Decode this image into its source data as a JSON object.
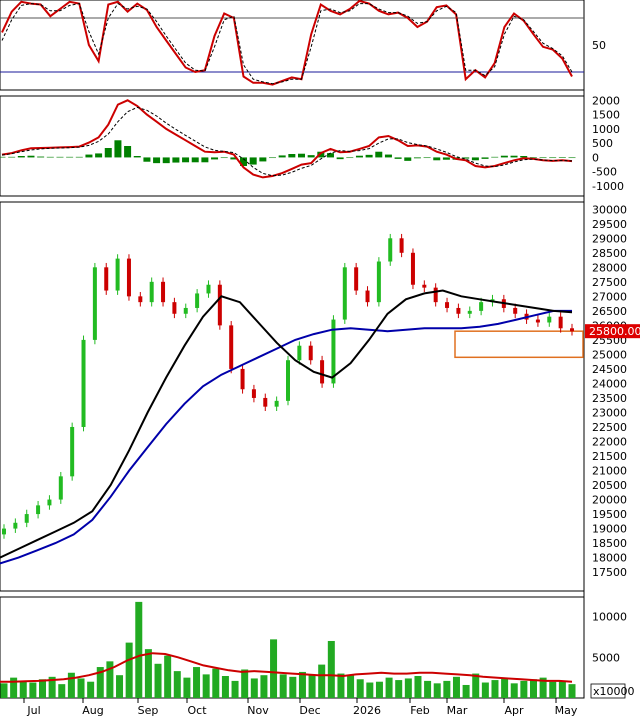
{
  "chart_data": [
    {
      "panel": "stochastic",
      "type": "line",
      "yticks": [
        50
      ],
      "ylim": [
        0,
        100
      ],
      "reference_lines": [
        80,
        20
      ],
      "series": [
        {
          "color": "#cc0000",
          "values": [
            64,
            87,
            98,
            96,
            95,
            82,
            90,
            98,
            96,
            50,
            32,
            95,
            98,
            87,
            96,
            89,
            70,
            55,
            40,
            25,
            20,
            22,
            60,
            85,
            80,
            15,
            8,
            8,
            6,
            10,
            14,
            12,
            62,
            95,
            88,
            84,
            90,
            99,
            96,
            88,
            84,
            86,
            80,
            70,
            76,
            92,
            94,
            84,
            12,
            22,
            14,
            30,
            70,
            85,
            77,
            62,
            48,
            45,
            35,
            15
          ]
        },
        {
          "color": "#000000",
          "dashed": true,
          "values": [
            55,
            78,
            94,
            96,
            95,
            88,
            88,
            94,
            96,
            65,
            40,
            80,
            96,
            90,
            93,
            90,
            76,
            60,
            45,
            30,
            22,
            21,
            48,
            78,
            82,
            28,
            12,
            9,
            7,
            9,
            12,
            12,
            48,
            88,
            90,
            86,
            88,
            96,
            96,
            90,
            86,
            86,
            82,
            74,
            76,
            88,
            93,
            86,
            22,
            22,
            16,
            26,
            62,
            82,
            78,
            65,
            52,
            46,
            38,
            20
          ]
        }
      ]
    },
    {
      "panel": "macd",
      "type": "line",
      "yticks": [
        2000,
        1500,
        1000,
        500,
        0,
        -500,
        -1000
      ],
      "ylim": [
        -1350,
        2150
      ],
      "series": [
        {
          "color": "#cc0000",
          "values": [
            100,
            150,
            250,
            320,
            330,
            340,
            350,
            360,
            380,
            520,
            700,
            1150,
            1850,
            2000,
            1800,
            1500,
            1250,
            1000,
            800,
            600,
            400,
            200,
            180,
            200,
            100,
            -350,
            -600,
            -700,
            -650,
            -550,
            -400,
            -250,
            -200,
            150,
            300,
            180,
            200,
            300,
            400,
            700,
            750,
            600,
            400,
            420,
            380,
            200,
            100,
            -50,
            -100,
            -300,
            -350,
            -300,
            -200,
            -100,
            -30,
            -50,
            -100,
            -120,
            -100,
            -130
          ]
        },
        {
          "color": "#000000",
          "dashed": true,
          "values": [
            80,
            130,
            200,
            260,
            300,
            320,
            330,
            340,
            360,
            420,
            560,
            820,
            1250,
            1600,
            1750,
            1650,
            1450,
            1200,
            980,
            770,
            570,
            370,
            250,
            210,
            170,
            -50,
            -350,
            -560,
            -640,
            -620,
            -520,
            -380,
            -280,
            -50,
            150,
            240,
            210,
            240,
            310,
            500,
            650,
            650,
            520,
            450,
            400,
            300,
            180,
            30,
            -60,
            -200,
            -300,
            -320,
            -260,
            -160,
            -80,
            -60,
            -90,
            -110,
            -110,
            -120
          ]
        }
      ],
      "histogram": {
        "color": "#008000",
        "values": [
          20,
          20,
          50,
          60,
          30,
          20,
          20,
          20,
          20,
          100,
          140,
          330,
          600,
          400,
          50,
          -150,
          -200,
          -200,
          -180,
          -170,
          -170,
          -170,
          -70,
          -10,
          -70,
          -300,
          -250,
          -140,
          -10,
          70,
          120,
          130,
          80,
          200,
          150,
          -60,
          -10,
          60,
          90,
          200,
          100,
          -50,
          -120,
          -30,
          -20,
          -100,
          -80,
          -80,
          -40,
          -100,
          -50,
          20,
          60,
          60,
          50,
          10,
          -10,
          -10,
          10,
          -10
        ]
      }
    },
    {
      "panel": "price",
      "type": "candlestick",
      "yticks": [
        30000,
        29500,
        29000,
        28500,
        28000,
        27500,
        27000,
        26500,
        26000,
        25500,
        25000,
        24500,
        24000,
        23500,
        23000,
        22500,
        22000,
        21500,
        21000,
        20500,
        20000,
        19500,
        19000,
        18500,
        18000,
        17500
      ],
      "ylim": [
        16850,
        30250
      ],
      "x": [
        "Jul",
        "Aug",
        "Sep",
        "Oct",
        "Nov",
        "Dec",
        "2026",
        "Feb",
        "Mar",
        "Apr",
        "May"
      ],
      "last_price": "25800.00",
      "close": [
        19000,
        19200,
        19500,
        19800,
        20000,
        20800,
        22500,
        25500,
        28000,
        27200,
        28300,
        27000,
        26800,
        27500,
        26800,
        26400,
        26600,
        27100,
        27400,
        26000,
        24500,
        23800,
        23500,
        23200,
        23400,
        24800,
        25300,
        24800,
        24000,
        26200,
        28000,
        27200,
        26800,
        28200,
        29000,
        28500,
        27400,
        27300,
        26800,
        26600,
        26400,
        26500,
        26800,
        26900,
        26600,
        26400,
        26200,
        26100,
        26300,
        25900,
        25800
      ],
      "sma_short": {
        "color": "#000000",
        "values": [
          18000,
          18300,
          18600,
          18900,
          19200,
          19600,
          20500,
          21700,
          23000,
          24200,
          25300,
          26300,
          27000,
          26800,
          26100,
          25400,
          24800,
          24400,
          24200,
          24700,
          25500,
          26400,
          26900,
          27100,
          27200,
          27000,
          26900,
          26800,
          26700,
          26600,
          26500,
          26450
        ]
      },
      "sma_long": {
        "color": "#0000aa",
        "values": [
          17800,
          18000,
          18250,
          18500,
          18800,
          19300,
          20100,
          21000,
          21800,
          22600,
          23300,
          23900,
          24300,
          24600,
          24900,
          25200,
          25500,
          25700,
          25850,
          25900,
          25850,
          25800,
          25850,
          25900,
          25900,
          25900,
          25950,
          26050,
          26200,
          26350,
          26500,
          26500
        ]
      },
      "support_box": {
        "color": "#e07020",
        "ylim": [
          24900,
          25800
        ]
      }
    },
    {
      "panel": "volume",
      "type": "bar",
      "yticks": [
        10000,
        5000
      ],
      "ylim": [
        0,
        12400
      ],
      "unit": "x10000",
      "values": [
        1800,
        2500,
        2100,
        1900,
        2300,
        2600,
        1700,
        3100,
        2400,
        2000,
        3800,
        4500,
        2800,
        6800,
        11800,
        6000,
        4200,
        5200,
        3300,
        2500,
        3800,
        2900,
        3600,
        2700,
        2100,
        3500,
        2400,
        2800,
        7200,
        2900,
        2600,
        3200,
        2900,
        4100,
        7000,
        3000,
        2800,
        2300,
        1900,
        2000,
        2500,
        2200,
        2400,
        2700,
        2100,
        1800,
        2100,
        2600,
        1600,
        3000,
        1900,
        2200,
        2400,
        1800,
        2100,
        2300,
        2500,
        2000,
        2100,
        1700
      ],
      "ma": {
        "color": "#cc0000",
        "values": [
          2000,
          2000,
          2050,
          2100,
          2200,
          2300,
          2500,
          2800,
          3200,
          3800,
          4600,
          5200,
          5500,
          5400,
          5000,
          4500,
          4000,
          3700,
          3400,
          3200,
          3300,
          3200,
          3100,
          3000,
          2900,
          2800,
          2800,
          2700,
          2900,
          3000,
          3100,
          3000,
          3000,
          3100,
          3100,
          3000,
          2900,
          2800,
          2600,
          2500,
          2400,
          2300,
          2200,
          2100,
          2100,
          2000
        ]
      }
    }
  ],
  "xaxis": {
    "labels": [
      "Jul",
      "Aug",
      "Sep",
      "Oct",
      "Nov",
      "Dec",
      "2026",
      "Feb",
      "Mar",
      "Apr",
      "May"
    ]
  },
  "volume_unit": "x10000",
  "last_price": "25800.00",
  "stoch_tick": "50",
  "macd_ticks": [
    "2000",
    "1500",
    "1000",
    "500",
    "0",
    "-500",
    "-1000"
  ],
  "price_ticks": [
    "30000",
    "29500",
    "29000",
    "28500",
    "28000",
    "27500",
    "27000",
    "26500",
    "26000",
    "25500",
    "25000",
    "24500",
    "24000",
    "23500",
    "23000",
    "22500",
    "22000",
    "21500",
    "21000",
    "20500",
    "20000",
    "19500",
    "19000",
    "18500",
    "18000",
    "17500"
  ],
  "volume_ticks": [
    "10000",
    "5000"
  ]
}
